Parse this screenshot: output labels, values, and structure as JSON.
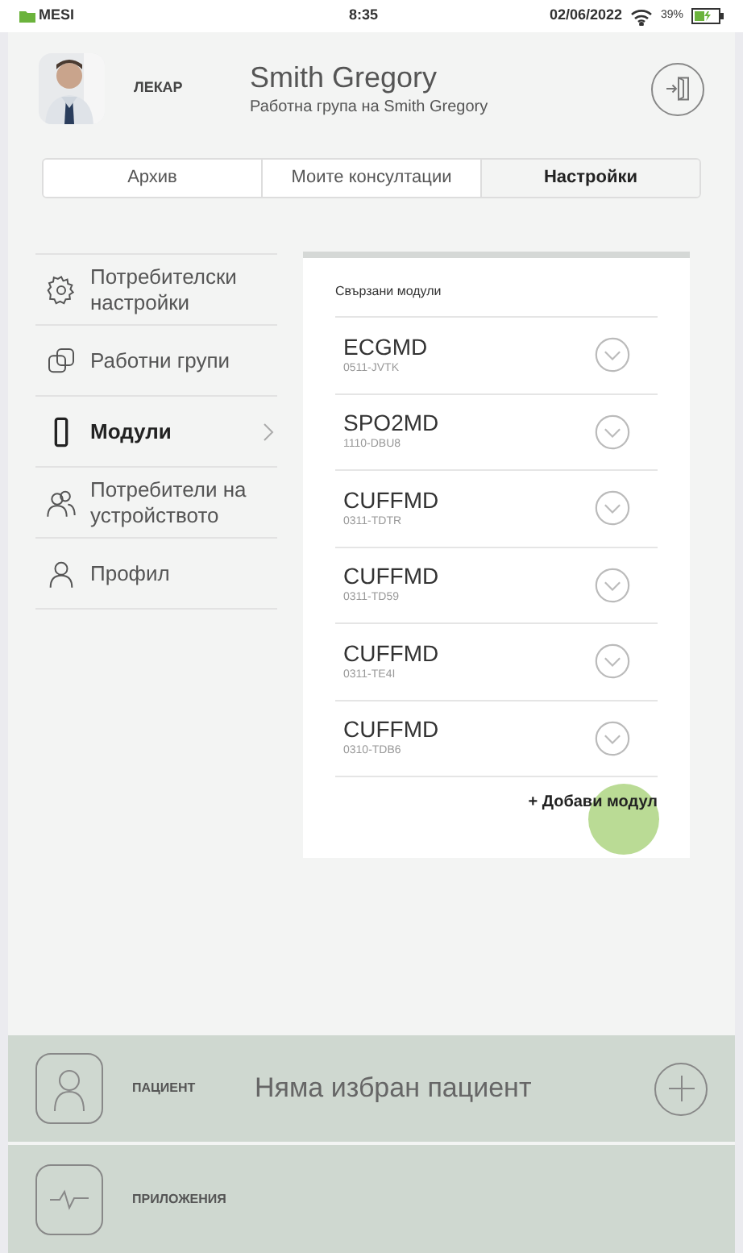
{
  "status_bar": {
    "brand": "MESI",
    "time": "8:35",
    "date": "02/06/2022",
    "battery": "39%"
  },
  "header": {
    "role": "ЛЕКАР",
    "name": "Smith Gregory",
    "group": "Работна група на Smith Gregory"
  },
  "tabs": [
    {
      "label": "Архив",
      "selected": false
    },
    {
      "label": "Моите консултации",
      "selected": false
    },
    {
      "label": "Настройки",
      "selected": true
    }
  ],
  "sidebar": {
    "items": [
      {
        "label": "Потребителски настройки",
        "kind": "gear",
        "selected": false
      },
      {
        "label": "Работни групи",
        "kind": "groups",
        "selected": false
      },
      {
        "label": "Модули",
        "kind": "module",
        "selected": true
      },
      {
        "label": "Потребители на устройството",
        "kind": "users",
        "selected": false
      },
      {
        "label": "Профил",
        "kind": "user",
        "selected": false
      }
    ]
  },
  "modules": {
    "title": "Свързани модули",
    "items": [
      {
        "name": "ECGMD",
        "code": "0511-JVTK"
      },
      {
        "name": "SPO2MD",
        "code": "1110-DBU8"
      },
      {
        "name": "CUFFMD",
        "code": "0311-TDTR"
      },
      {
        "name": "CUFFMD",
        "code": "0311-TD59"
      },
      {
        "name": "CUFFMD",
        "code": "0311-TE4I"
      },
      {
        "name": "CUFFMD",
        "code": "0310-TDB6"
      }
    ],
    "add": "+ Добави модул"
  },
  "bottom": {
    "patient_label": "ПАЦИЕНТ",
    "patient_value": "Няма избран пациент",
    "apps_label": "ПРИЛОЖЕНИЯ"
  }
}
